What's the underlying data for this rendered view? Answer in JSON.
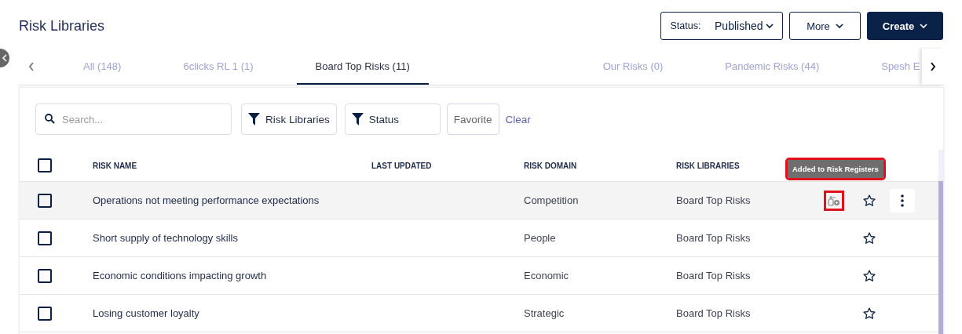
{
  "page": {
    "title": "Risk Libraries"
  },
  "header_buttons": [
    {
      "kind": "status",
      "label": "Status:",
      "value": "Published"
    },
    {
      "kind": "plain",
      "label": "More"
    },
    {
      "kind": "primary",
      "label": "Create"
    }
  ],
  "tabs": [
    {
      "label": "All (148)",
      "selected": false
    },
    {
      "label": "6clicks RL 1 (1)",
      "selected": false
    },
    {
      "label": "Board Top Risks (11)",
      "selected": true
    },
    {
      "label": "Our Risks (0)",
      "selected": false
    },
    {
      "label": "Pandemic Risks (44)",
      "selected": false
    },
    {
      "label": "Spesh E",
      "selected": false
    }
  ],
  "filters": {
    "search": {
      "placeholder": "Search..."
    },
    "buttons": [
      {
        "kind": "filter",
        "label": "Risk Libraries"
      },
      {
        "kind": "filter",
        "label": "Status"
      },
      {
        "kind": "plain",
        "label": "Favorite"
      }
    ],
    "clear": "Clear"
  },
  "table": {
    "select_all": {
      "checked": false
    },
    "columns": [
      "RISK NAME",
      "LAST UPDATED",
      "RISK DOMAIN",
      "RISK LIBRARIES"
    ],
    "tooltip": {
      "text": "Added to Risk Registers",
      "highlighted": true
    },
    "rows": [
      {
        "name": "Operations not meeting performance expectations",
        "last_updated": "",
        "domain": "Competition",
        "library": "Board Top Risks",
        "checked": false,
        "hovered": true,
        "favorite": false,
        "register_icon_highlighted": true
      },
      {
        "name": "Short supply of technology skills",
        "domain": "People",
        "library": "Board Top Risks",
        "checked": false,
        "hovered": false,
        "favorite": false
      },
      {
        "name": "Economic conditions impacting growth",
        "domain": "Economic",
        "library": "Board Top Risks",
        "checked": false,
        "hovered": false,
        "favorite": false
      },
      {
        "name": "Losing customer loyalty",
        "domain": "Strategic",
        "library": "Board Top Risks",
        "checked": false,
        "hovered": false,
        "favorite": false
      }
    ]
  }
}
